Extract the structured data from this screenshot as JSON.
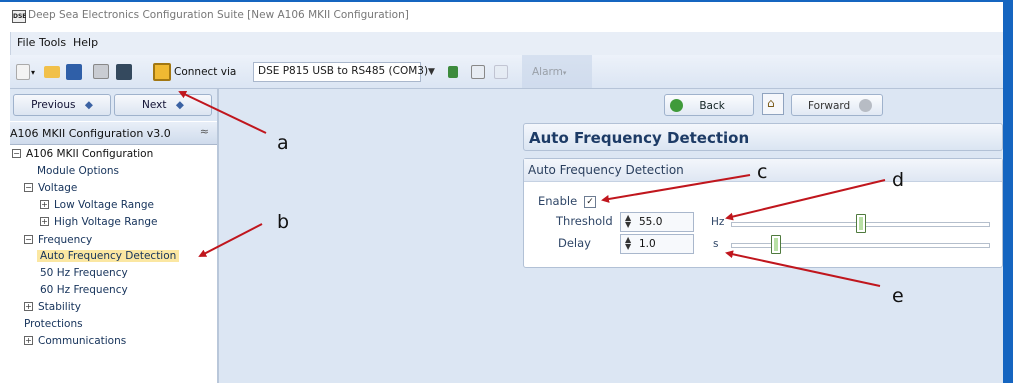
{
  "window": {
    "title": "Deep Sea Electronics Configuration Suite [New A106 MKII Configuration]",
    "app_icon": "DSE"
  },
  "menubar": {
    "file": "File",
    "tools": "Tools",
    "help": "Help"
  },
  "toolbar": {
    "connect_label": "Connect via",
    "connection_value": "DSE P815 USB to RS485 (COM3)",
    "alarm_label": "Alarm",
    "icons": [
      "new-icon",
      "open-icon",
      "save-icon",
      "print-icon",
      "read-from-module-icon",
      "write-to-module-icon",
      "module-status-icon",
      "scada-icon",
      "disconnect-icon"
    ]
  },
  "sidebar": {
    "previous_label": "Previous",
    "next_label": "Next",
    "panel_title": "A106 MKII Configuration v3.0",
    "tree": {
      "root": "A106 MKII Configuration",
      "module_options": "Module Options",
      "voltage": "Voltage",
      "low_voltage_range": "Low Voltage Range",
      "high_voltage_range": "High Voltage Range",
      "frequency": "Frequency",
      "auto_frequency_detection": "Auto Frequency Detection",
      "hz50": "50 Hz Frequency",
      "hz60": "60 Hz Frequency",
      "stability": "Stability",
      "protections": "Protections",
      "communications": "Communications"
    }
  },
  "main": {
    "back_label": "Back",
    "forward_label": "Forward",
    "page_title": "Auto Frequency Detection",
    "group_title": "Auto Frequency Detection",
    "enable_label": "Enable",
    "enable_checked": true,
    "threshold_label": "Threshold",
    "threshold_value": "55.0",
    "threshold_unit": "Hz",
    "threshold_slider_fraction": 0.5,
    "delay_label": "Delay",
    "delay_value": "1.0",
    "delay_unit": "s",
    "delay_slider_fraction": 0.17
  },
  "annotations": {
    "a": "a",
    "b": "b",
    "c": "c",
    "d": "d",
    "e": "e"
  },
  "colors": {
    "accent_blue": "#1565c0",
    "annotation_red": "#c0161d",
    "selection": "#fbe7a2"
  }
}
